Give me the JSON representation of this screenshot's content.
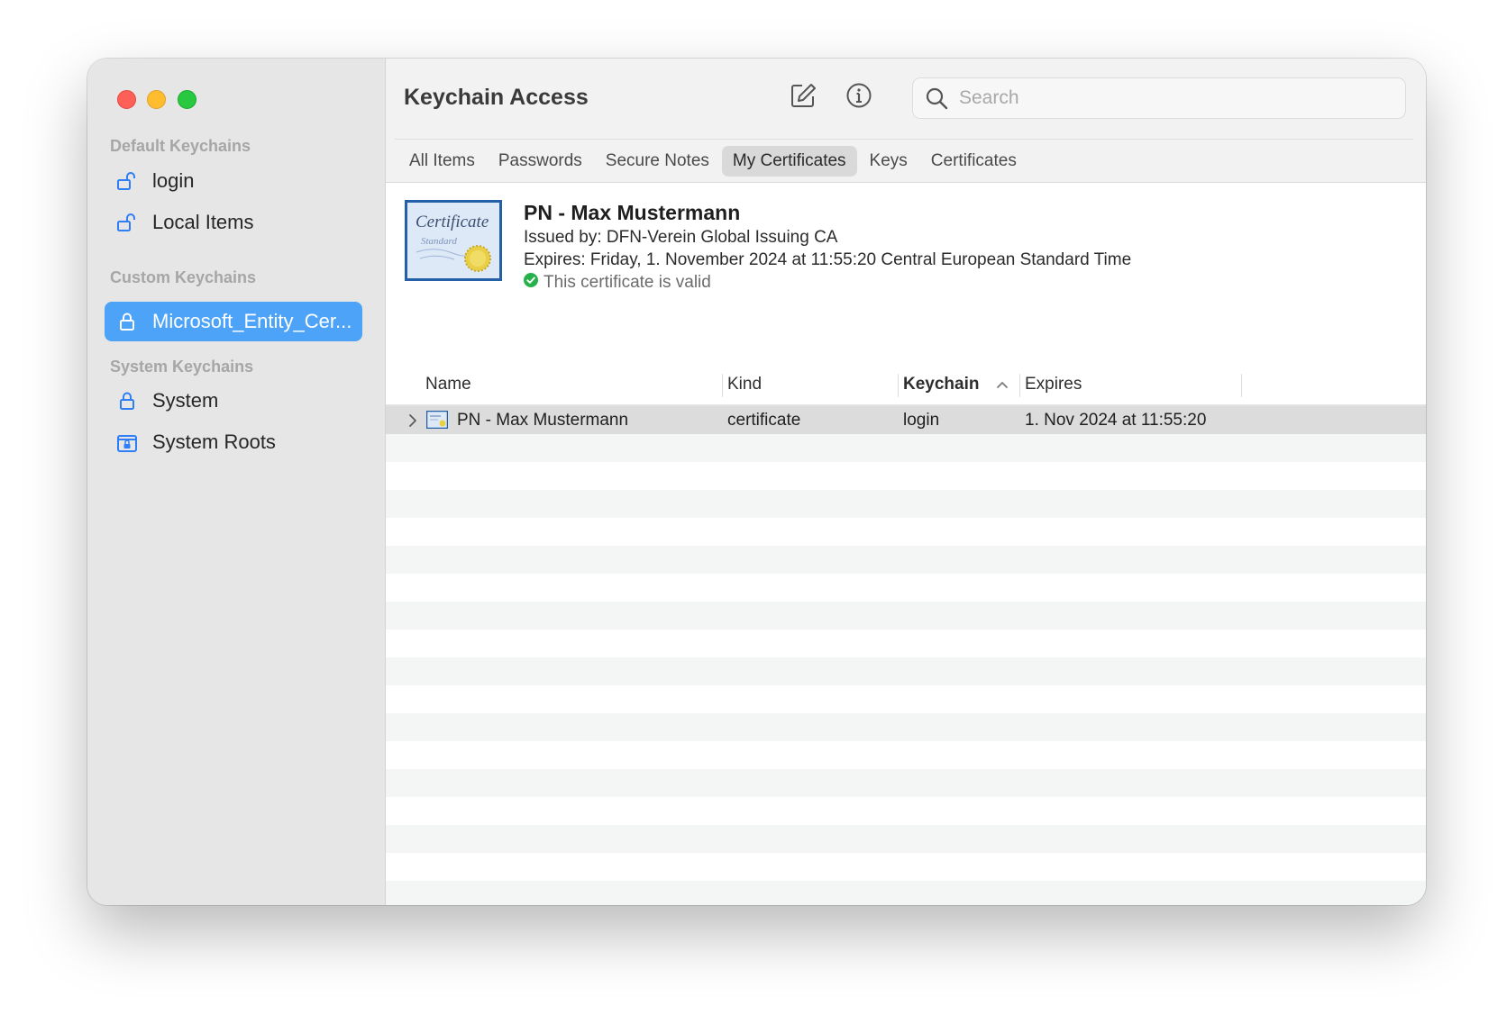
{
  "sidebar": {
    "default_title": "Default Keychains",
    "custom_title": "Custom Keychains",
    "system_title": "System Keychains",
    "items": [
      {
        "label": "login",
        "icon": "unlocked-padlock-icon"
      },
      {
        "label": "Local Items",
        "icon": "unlocked-padlock-icon"
      },
      {
        "label": "Microsoft_Entity_Cer...",
        "icon": "locked-padlock-icon",
        "selected": true
      },
      {
        "label": "System",
        "icon": "locked-padlock-icon"
      },
      {
        "label": "System Roots",
        "icon": "locked-cabinet-icon"
      }
    ]
  },
  "toolbar": {
    "title": "Keychain Access",
    "compose_icon": "compose-icon",
    "info_icon": "info-icon",
    "search_placeholder": "Search"
  },
  "tabs": [
    {
      "label": "All Items"
    },
    {
      "label": "Passwords"
    },
    {
      "label": "Secure Notes"
    },
    {
      "label": "My Certificates",
      "active": true
    },
    {
      "label": "Keys"
    },
    {
      "label": "Certificates"
    }
  ],
  "detail": {
    "name": "PN - Max Mustermann",
    "issued_by": "Issued by: DFN-Verein Global Issuing CA",
    "expires": "Expires: Friday, 1. November 2024 at 11:55:20 Central European Standard Time",
    "status": "This certificate is valid",
    "cert_title": "Certificate",
    "cert_subtitle": "Standard"
  },
  "table": {
    "columns": {
      "name": "Name",
      "kind": "Kind",
      "keychain": "Keychain",
      "expires": "Expires"
    },
    "sorted_column": "Keychain",
    "rows": [
      {
        "name": "PN - Max Mustermann",
        "kind": "certificate",
        "keychain": "login",
        "expires": "1. Nov 2024 at 11:55:20"
      }
    ]
  },
  "colors": {
    "accent": "#4da3f7",
    "valid_green": "#27b14d",
    "close": "#fe5f57",
    "minimize": "#febc2e",
    "maximize": "#28c840"
  }
}
